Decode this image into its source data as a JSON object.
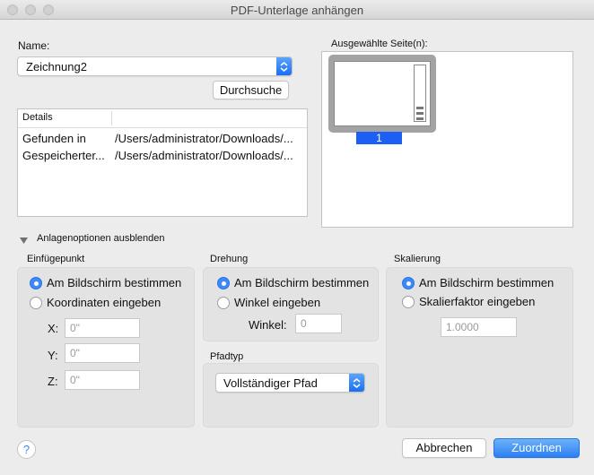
{
  "window": {
    "title": "PDF-Unterlage anhängen"
  },
  "name_section": {
    "label": "Name:",
    "selected": "Zeichnung2",
    "browse_label": "Durchsuche"
  },
  "details": {
    "header": "Details",
    "rows": [
      {
        "key": "Gefunden in",
        "value": "/Users/administrator/Downloads/..."
      },
      {
        "key": "Gespeicherter...",
        "value": "/Users/administrator/Downloads/..."
      }
    ]
  },
  "pages": {
    "label": "Ausgewählte Seite(n):",
    "items": [
      {
        "number": "1"
      }
    ]
  },
  "toggle": {
    "label": "Anlagenoptionen ausblenden"
  },
  "insertion": {
    "title": "Einfügepunkt",
    "options": [
      "Am Bildschirm bestimmen",
      "Koordinaten eingeben"
    ],
    "selected_index": 0,
    "x_label": "X:",
    "x_value": "0\"",
    "y_label": "Y:",
    "y_value": "0\"",
    "z_label": "Z:",
    "z_value": "0\""
  },
  "rotation": {
    "title": "Drehung",
    "options": [
      "Am Bildschirm bestimmen",
      "Winkel eingeben"
    ],
    "selected_index": 0,
    "angle_label": "Winkel:",
    "angle_value": "0"
  },
  "path_type": {
    "title": "Pfadtyp",
    "selected": "Vollständiger Pfad"
  },
  "scale": {
    "title": "Skalierung",
    "options": [
      "Am Bildschirm bestimmen",
      "Skalierfaktor eingeben"
    ],
    "selected_index": 0,
    "factor_value": "1.0000"
  },
  "footer": {
    "help_label": "?",
    "cancel_label": "Abbrechen",
    "ok_label": "Zuordnen"
  },
  "colors": {
    "accent": "#2c7ef3",
    "page_number_bg": "#1c5ff5"
  }
}
